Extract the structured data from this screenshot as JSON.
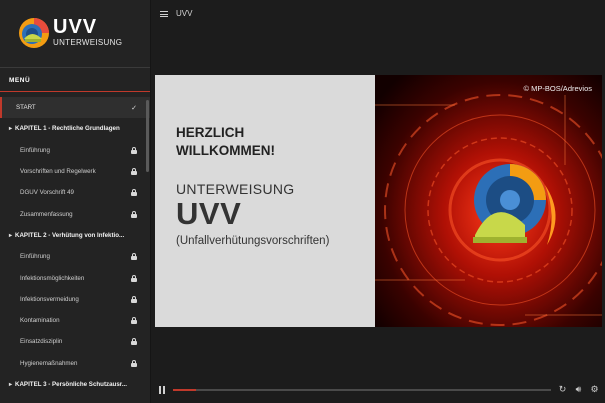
{
  "app": {
    "logo_title": "UVV",
    "logo_subtitle": "UNTERWEISUNG",
    "top_title": "UVV"
  },
  "sidebar": {
    "menu_label": "MENÜ",
    "items": [
      {
        "label": "START",
        "kind": "start",
        "status": "done"
      },
      {
        "label": "KAPITEL 1 - Rechtliche Grundlagen",
        "kind": "chapter"
      },
      {
        "label": "Einführung",
        "kind": "item",
        "status": "locked"
      },
      {
        "label": "Vorschriften und Regelwerk",
        "kind": "item",
        "status": "locked"
      },
      {
        "label": "DGUV Vorschrift 49",
        "kind": "item",
        "status": "locked"
      },
      {
        "label": "Zusammenfassung",
        "kind": "item",
        "status": "locked"
      },
      {
        "label": "KAPITEL 2 - Verhütung von Infektio...",
        "kind": "chapter"
      },
      {
        "label": "Einführung",
        "kind": "item",
        "status": "locked"
      },
      {
        "label": "Infektionsmöglichkeiten",
        "kind": "item",
        "status": "locked"
      },
      {
        "label": "Infektionsvermeidung",
        "kind": "item",
        "status": "locked"
      },
      {
        "label": "Kontamination",
        "kind": "item",
        "status": "locked"
      },
      {
        "label": "Einsatzdisziplin",
        "kind": "item",
        "status": "locked"
      },
      {
        "label": "Hygienemaßnahmen",
        "kind": "item",
        "status": "locked"
      },
      {
        "label": "KAPITEL 3 - Persönliche Schutzausr...",
        "kind": "chapter"
      }
    ]
  },
  "slide": {
    "heading_line1": "HERZLICH",
    "heading_line2": "WILLKOMMEN!",
    "subtitle1": "UNTERWEISUNG",
    "subtitle2": "UVV",
    "subtitle3": "(Unfallverhütungsvorschriften)",
    "copyright": "© MP-BOS/Adrevios"
  },
  "player": {
    "progress": 0.06
  },
  "icons": {
    "menu": "hamburger-icon",
    "done": "check-icon",
    "locked": "lock-icon",
    "pause": "pause-icon",
    "replay": "replay-icon",
    "volume": "volume-icon",
    "settings": "gear-icon"
  },
  "colors": {
    "accent": "#c0392b",
    "sidebar_bg": "#232323",
    "app_bg": "#1c1c1c",
    "slide_panel": "#dadada"
  }
}
